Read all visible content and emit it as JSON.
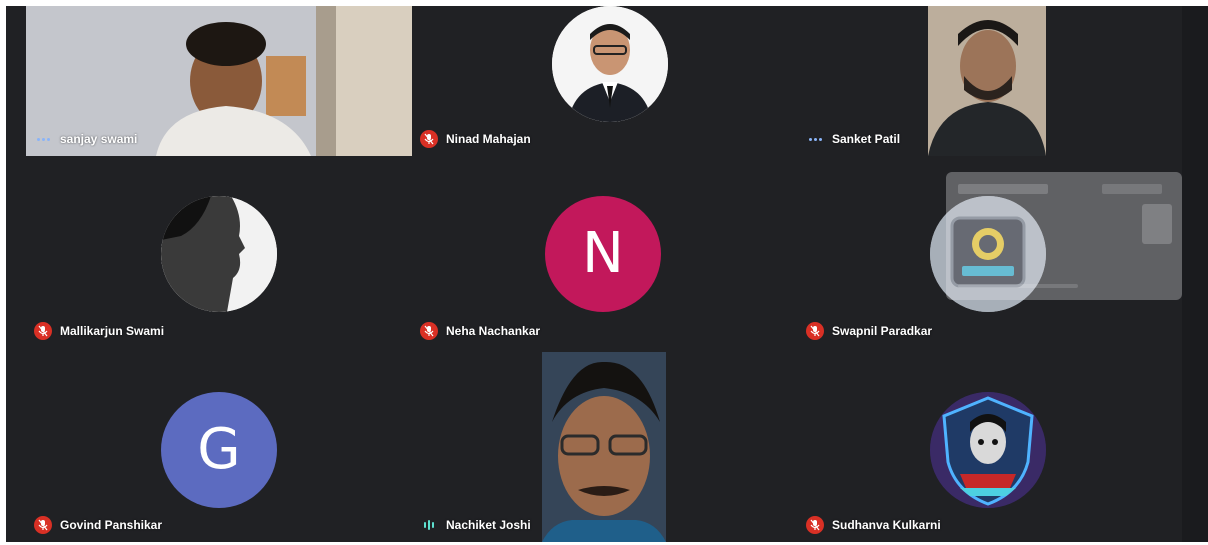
{
  "participants": [
    {
      "name": "sanjay swami",
      "status": "speaking-dots",
      "view": "video"
    },
    {
      "name": "Ninad Mahajan",
      "status": "muted",
      "view": "avatar-photo"
    },
    {
      "name": "Sanket Patil",
      "status": "speaking-dots",
      "view": "video"
    },
    {
      "name": "Mallikarjun Swami",
      "status": "muted",
      "view": "avatar-photo"
    },
    {
      "name": "Neha Nachankar",
      "status": "muted",
      "view": "letter-avatar",
      "letter": "N",
      "color": "#c2185b"
    },
    {
      "name": "Swapnil Paradkar",
      "status": "muted",
      "view": "avatar-logo"
    },
    {
      "name": "Govind Panshikar",
      "status": "muted",
      "view": "letter-avatar",
      "letter": "G",
      "color": "#5c6bc0"
    },
    {
      "name": "Nachiket Joshi",
      "status": "speaking-eq",
      "view": "video"
    },
    {
      "name": "Sudhanva Kulkarni",
      "status": "muted",
      "view": "avatar-logo"
    }
  ],
  "colors": {
    "background": "#202124",
    "mic_off": "#d93025",
    "speaking_eq": "#5ee0d0"
  }
}
